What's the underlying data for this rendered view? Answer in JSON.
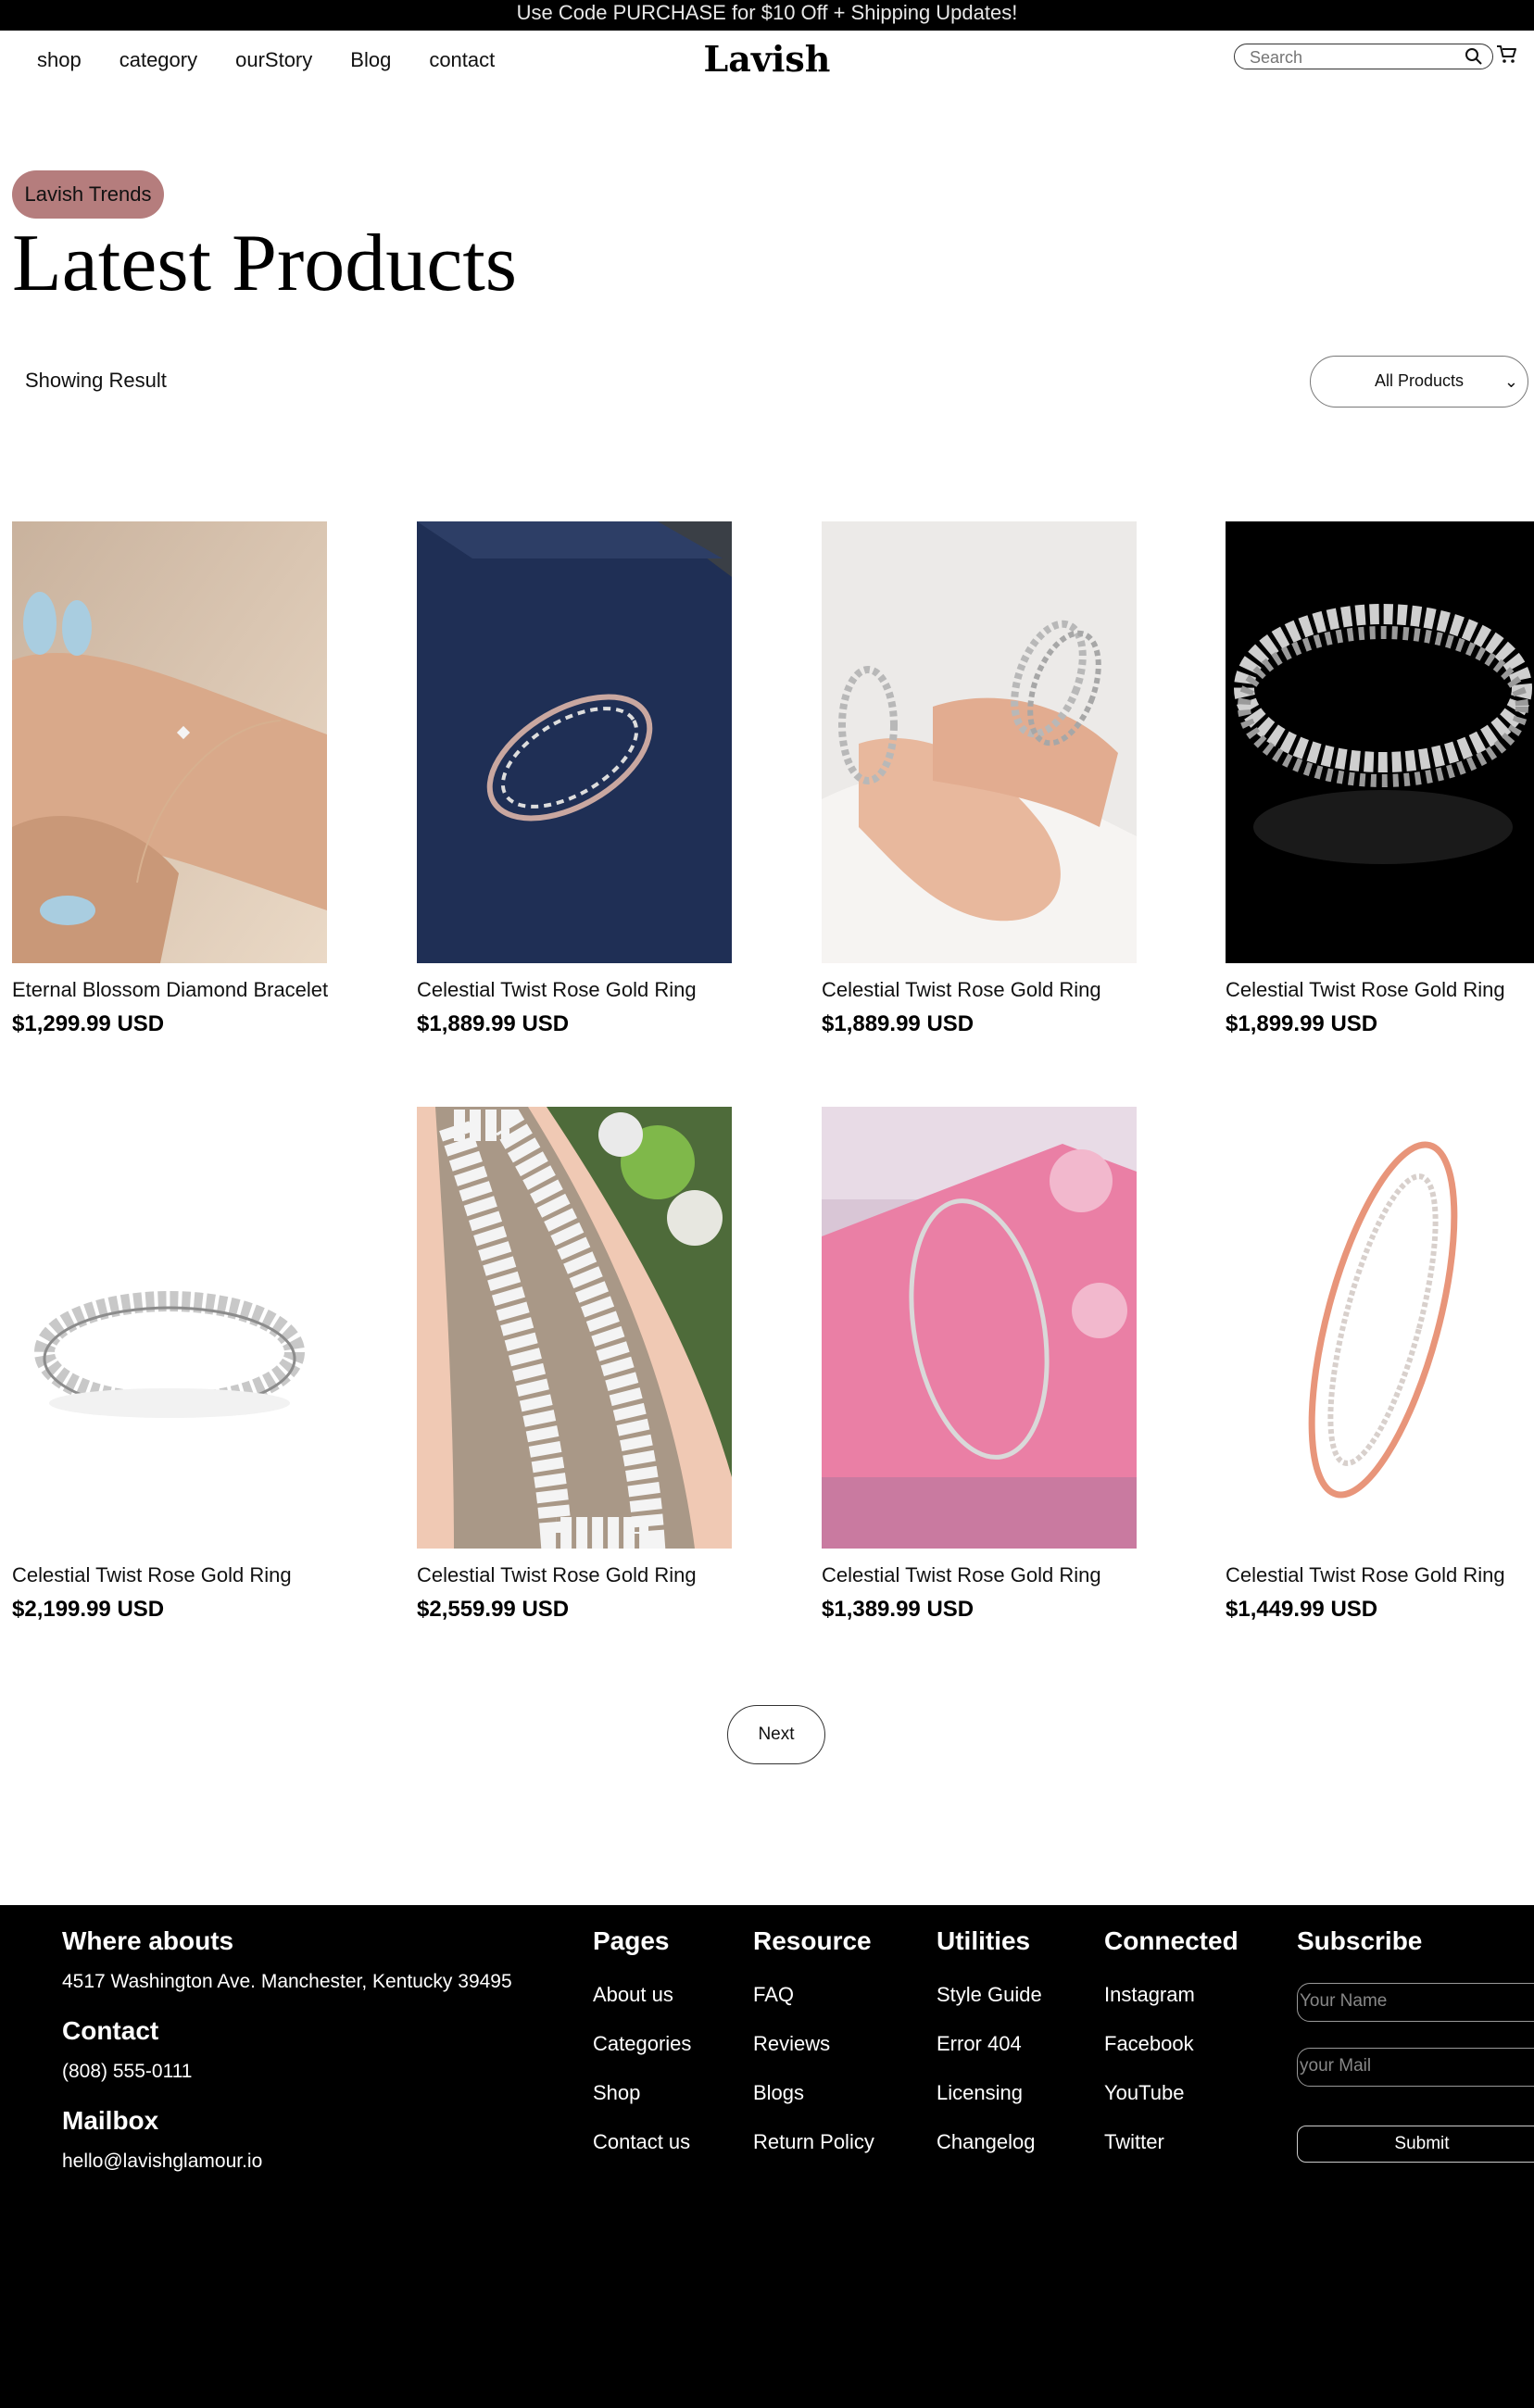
{
  "announcement": "Use Code PURCHASE for $10 Off + Shipping Updates!",
  "nav": {
    "links": [
      "shop",
      "category",
      "ourStory",
      "Blog",
      "contact"
    ],
    "logo": "Lavish",
    "search_placeholder": "Search"
  },
  "hero": {
    "tag": "Lavish Trends",
    "title": "Latest Products"
  },
  "toolbar": {
    "showing": "Showing Result",
    "filter_selected": "All Products"
  },
  "products": [
    {
      "name": "Eternal Blossom Diamond Bracelet",
      "price": "$1,299.99 USD"
    },
    {
      "name": "Celestial Twist Rose Gold Ring",
      "price": "$1,889.99 USD"
    },
    {
      "name": "Celestial Twist Rose Gold Ring",
      "price": "$1,889.99 USD"
    },
    {
      "name": "Celestial Twist Rose Gold Ring",
      "price": "$1,899.99 USD"
    },
    {
      "name": "Celestial Twist Rose Gold Ring",
      "price": "$2,199.99 USD"
    },
    {
      "name": "Celestial Twist Rose Gold Ring",
      "price": "$2,559.99 USD"
    },
    {
      "name": "Celestial Twist Rose Gold Ring",
      "price": "$1,389.99 USD"
    },
    {
      "name": "Celestial Twist Rose Gold Ring",
      "price": "$1,449.99 USD"
    }
  ],
  "pagination": {
    "next": "Next"
  },
  "footer": {
    "whereabouts": {
      "heading": "Where abouts",
      "text": "4517 Washington Ave. Manchester, Kentucky 39495"
    },
    "contact": {
      "heading": "Contact",
      "text": "(808) 555-0111"
    },
    "mailbox": {
      "heading": "Mailbox",
      "text": "hello@lavishglamour.io"
    },
    "pages": {
      "heading": "Pages",
      "links": [
        "About us",
        "Categories",
        "Shop",
        "Contact us"
      ]
    },
    "resource": {
      "heading": "Resource",
      "links": [
        "FAQ",
        "Reviews",
        "Blogs",
        "Return Policy"
      ]
    },
    "utilities": {
      "heading": "Utilities",
      "links": [
        "Style Guide",
        "Error 404",
        "Licensing",
        "Changelog"
      ]
    },
    "connected": {
      "heading": "Connected",
      "links": [
        "Instagram",
        "Facebook",
        "YouTube",
        "Twitter"
      ]
    },
    "subscribe": {
      "heading": "Subscribe",
      "name_placeholder": "Your Name",
      "mail_placeholder": "your Mail",
      "submit": "Submit"
    }
  },
  "colors": {
    "accent_pill": "#b57d7d",
    "footer_bg": "#000000",
    "topbar_bg": "#000000"
  }
}
